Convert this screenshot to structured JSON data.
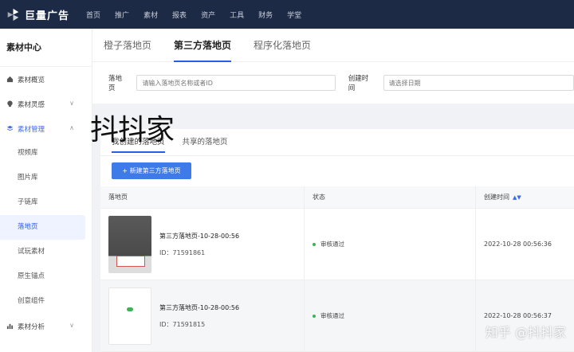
{
  "brand": {
    "name": "巨量广告"
  },
  "topnav": [
    "首页",
    "推广",
    "素材",
    "报表",
    "资产",
    "工具",
    "财务",
    "学堂"
  ],
  "sidebar": {
    "title": "素材中心",
    "items": [
      {
        "label": "素材概览",
        "icon": "home-icon",
        "type": "group"
      },
      {
        "label": "素材灵感",
        "icon": "bulb-icon",
        "type": "group",
        "chevron": "∨"
      },
      {
        "label": "素材管理",
        "icon": "layers-icon",
        "type": "group",
        "chevron": "∧",
        "active": true
      },
      {
        "label": "视频库",
        "type": "sub"
      },
      {
        "label": "图片库",
        "type": "sub"
      },
      {
        "label": "子链库",
        "type": "sub"
      },
      {
        "label": "落地页",
        "type": "sub",
        "selected": true
      },
      {
        "label": "试玩素材",
        "type": "sub"
      },
      {
        "label": "原生锚点",
        "type": "sub"
      },
      {
        "label": "创意组件",
        "type": "sub"
      },
      {
        "label": "素材分析",
        "icon": "chart-icon",
        "type": "group",
        "chevron": "∨"
      }
    ]
  },
  "tabs": [
    {
      "label": "橙子落地页"
    },
    {
      "label": "第三方落地页",
      "active": true
    },
    {
      "label": "程序化落地页"
    }
  ],
  "filters": {
    "landing_label": "落地页",
    "landing_placeholder": "请输入落地页名称或者ID",
    "created_label": "创建时间",
    "created_placeholder": "请选择日期"
  },
  "overlay_text": "抖抖家",
  "subtabs": [
    {
      "label": "我创建的落地页",
      "active": true
    },
    {
      "label": "共享的落地页"
    }
  ],
  "new_button": "+ 新建第三方落地页",
  "table": {
    "headers": {
      "name": "落地页",
      "status": "状态",
      "created": "创建时间"
    },
    "rows": [
      {
        "name": "第三方落地页-10-28-00:56",
        "id": "ID：71591861",
        "status": "审核通过",
        "created": "2022-10-28 00:56:36",
        "thumb": "dark"
      },
      {
        "name": "第三方落地页-10-28-00:56",
        "id": "ID：71591815",
        "status": "审核通过",
        "created": "2022-10-28 00:56:37",
        "thumb": "light"
      }
    ]
  },
  "watermark": "知乎 @抖抖家",
  "colors": {
    "accent": "#2b5ce6",
    "topbar": "#1c2a45",
    "success": "#3cb454"
  }
}
